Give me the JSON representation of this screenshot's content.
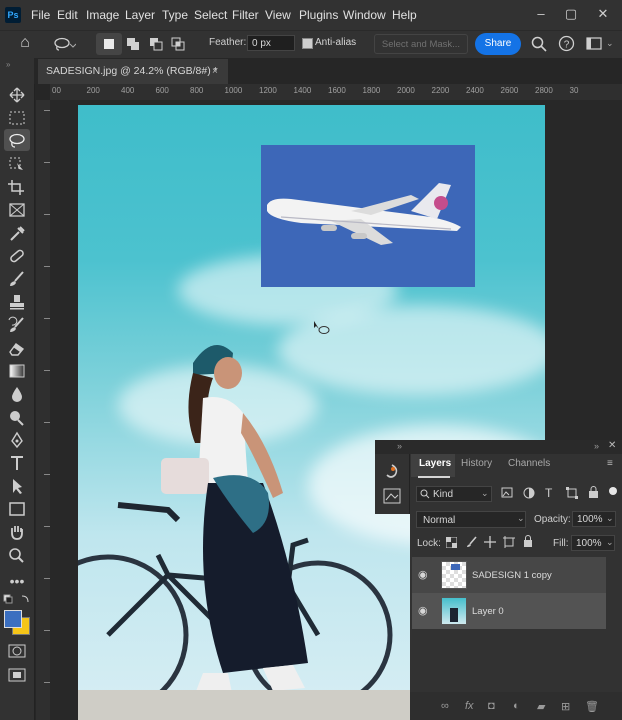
{
  "menu": [
    "File",
    "Edit",
    "Image",
    "Layer",
    "Type",
    "Select",
    "Filter",
    "View",
    "Plugins",
    "Window",
    "Help"
  ],
  "app_logo": "Ps",
  "options": {
    "feather_label": "Feather:",
    "feather_value": "0 px",
    "antialias_label": "Anti-alias",
    "select_mask_label": "Select and Mask...",
    "share_label": "Share"
  },
  "document": {
    "tab_title": "SADESIGN.jpg @ 24.2% (RGB/8#) *",
    "tab_close": "×"
  },
  "ruler_ticks": [
    "00",
    "200",
    "400",
    "600",
    "800",
    "1000",
    "1200",
    "1400",
    "1600",
    "1800",
    "2000",
    "2200",
    "2400",
    "2600",
    "2800",
    "30"
  ],
  "layers_panel": {
    "tabs": [
      "Layers",
      "History",
      "Channels"
    ],
    "active_tab": "Layers",
    "kind_label": "Kind",
    "blend_mode": "Normal",
    "opacity_label": "Opacity:",
    "opacity_value": "100%",
    "lock_label": "Lock:",
    "fill_label": "Fill:",
    "fill_value": "100%",
    "layers": [
      {
        "name": "SADESIGN 1 copy"
      },
      {
        "name": "Layer 0"
      }
    ]
  },
  "colors": {
    "accent": "#1473e6",
    "foreground": "#3b6fc0",
    "background": "#f5c518"
  },
  "icons": {
    "home": "⌂",
    "search": "⌕",
    "help": "?",
    "workspace": "▭",
    "gear": "⚙"
  }
}
